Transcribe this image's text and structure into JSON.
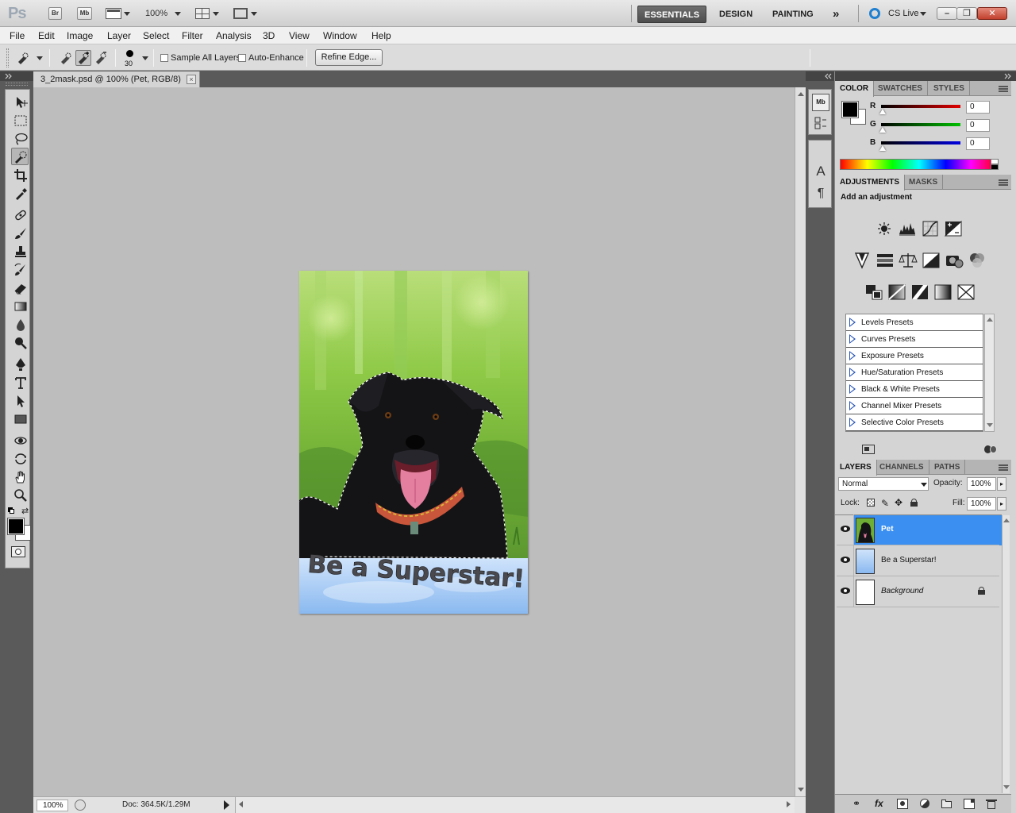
{
  "app": {
    "logo": "Ps",
    "bridge_btn": "Br",
    "minibridge_btn": "Mb",
    "zoom_level": "100%",
    "workspaces": [
      "ESSENTIALS",
      "DESIGN",
      "PAINTING"
    ],
    "more_workspaces": "»",
    "cslive": "CS Live",
    "min": "–",
    "restore": "❐",
    "close": "✕"
  },
  "menu": [
    "File",
    "Edit",
    "Image",
    "Layer",
    "Select",
    "Filter",
    "Analysis",
    "3D",
    "View",
    "Window",
    "Help"
  ],
  "options": {
    "brush_size": "30",
    "sample_all_layers": "Sample All Layers",
    "auto_enhance": "Auto-Enhance",
    "refine_edge": "Refine Edge..."
  },
  "document": {
    "tab_title": "3_2mask.psd @ 100% (Pet, RGB/8)",
    "close": "×",
    "image_text": "Be a Superstar!"
  },
  "status": {
    "zoom": "100%",
    "doc_size": "Doc: 364.5K/1.29M"
  },
  "color_panel": {
    "tabs": [
      "COLOR",
      "SWATCHES",
      "STYLES"
    ],
    "channels": [
      {
        "label": "R",
        "value": "0",
        "color": "#e00000"
      },
      {
        "label": "G",
        "value": "0",
        "color": "#00b000"
      },
      {
        "label": "B",
        "value": "0",
        "color": "#0000e0"
      }
    ]
  },
  "adjustments_panel": {
    "tabs": [
      "ADJUSTMENTS",
      "MASKS"
    ],
    "heading": "Add an adjustment",
    "presets": [
      "Levels Presets",
      "Curves Presets",
      "Exposure Presets",
      "Hue/Saturation Presets",
      "Black & White Presets",
      "Channel Mixer Presets",
      "Selective Color Presets"
    ]
  },
  "layers_panel": {
    "tabs": [
      "LAYERS",
      "CHANNELS",
      "PATHS"
    ],
    "blend_mode": "Normal",
    "opacity_label": "Opacity:",
    "opacity": "100%",
    "lock_label": "Lock:",
    "fill_label": "Fill:",
    "fill": "100%",
    "layers": [
      {
        "name": "Pet",
        "selected": true
      },
      {
        "name": "Be a Superstar!",
        "selected": false
      },
      {
        "name": "Background",
        "selected": false
      }
    ]
  },
  "colors": {
    "selection_blue": "#3a8ff0",
    "foreground": "#000000",
    "background": "#ffffff"
  }
}
